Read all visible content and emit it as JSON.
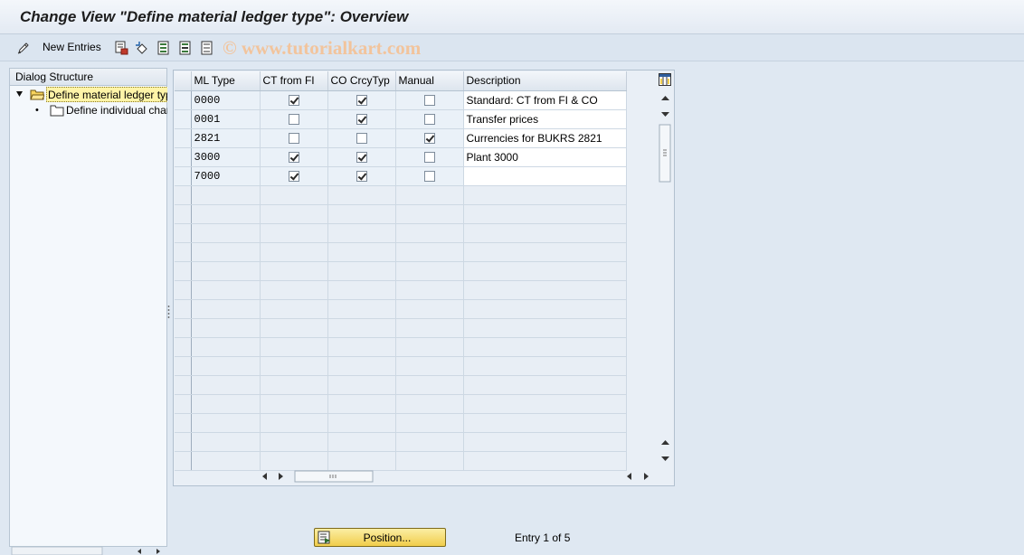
{
  "window": {
    "title": "Change View \"Define material ledger type\": Overview"
  },
  "toolbar": {
    "new_entries_label": "New Entries",
    "icons": [
      "edit-pencil-icon",
      "copy-as-icon",
      "undo-change-icon",
      "select-all-icon",
      "select-block-icon",
      "deselect-all-icon"
    ],
    "watermark": "© www.tutorialkart.com"
  },
  "dialog_structure": {
    "header": "Dialog Structure",
    "items": [
      {
        "label": "Define material ledger type",
        "level": 0,
        "selected": true,
        "expanded": true
      },
      {
        "label": "Define individual characteristics",
        "level": 1,
        "selected": false
      }
    ]
  },
  "table": {
    "columns": [
      "ML Type",
      "CT from FI",
      "CO CrcyTyp",
      "Manual",
      "Description"
    ],
    "rows": [
      {
        "ml_type": "0000",
        "ct_from_fi": true,
        "co_crcytyp": true,
        "manual": false,
        "description": "Standard: CT from FI & CO"
      },
      {
        "ml_type": "0001",
        "ct_from_fi": false,
        "co_crcytyp": true,
        "manual": false,
        "description": "Transfer prices"
      },
      {
        "ml_type": "2821",
        "ct_from_fi": false,
        "co_crcytyp": false,
        "manual": true,
        "description": "Currencies for BUKRS 2821"
      },
      {
        "ml_type": "3000",
        "ct_from_fi": true,
        "co_crcytyp": true,
        "manual": false,
        "description": "Plant 3000"
      },
      {
        "ml_type": "7000",
        "ct_from_fi": true,
        "co_crcytyp": true,
        "manual": false,
        "description": ""
      }
    ],
    "empty_rows": 15
  },
  "footer": {
    "position_button_label": "Position...",
    "entry_info": "Entry 1 of 5"
  },
  "colors": {
    "background": "#dfe8f2",
    "selected_tree_item": "#fff4a8",
    "button_yellow": "#f1cd4b"
  }
}
